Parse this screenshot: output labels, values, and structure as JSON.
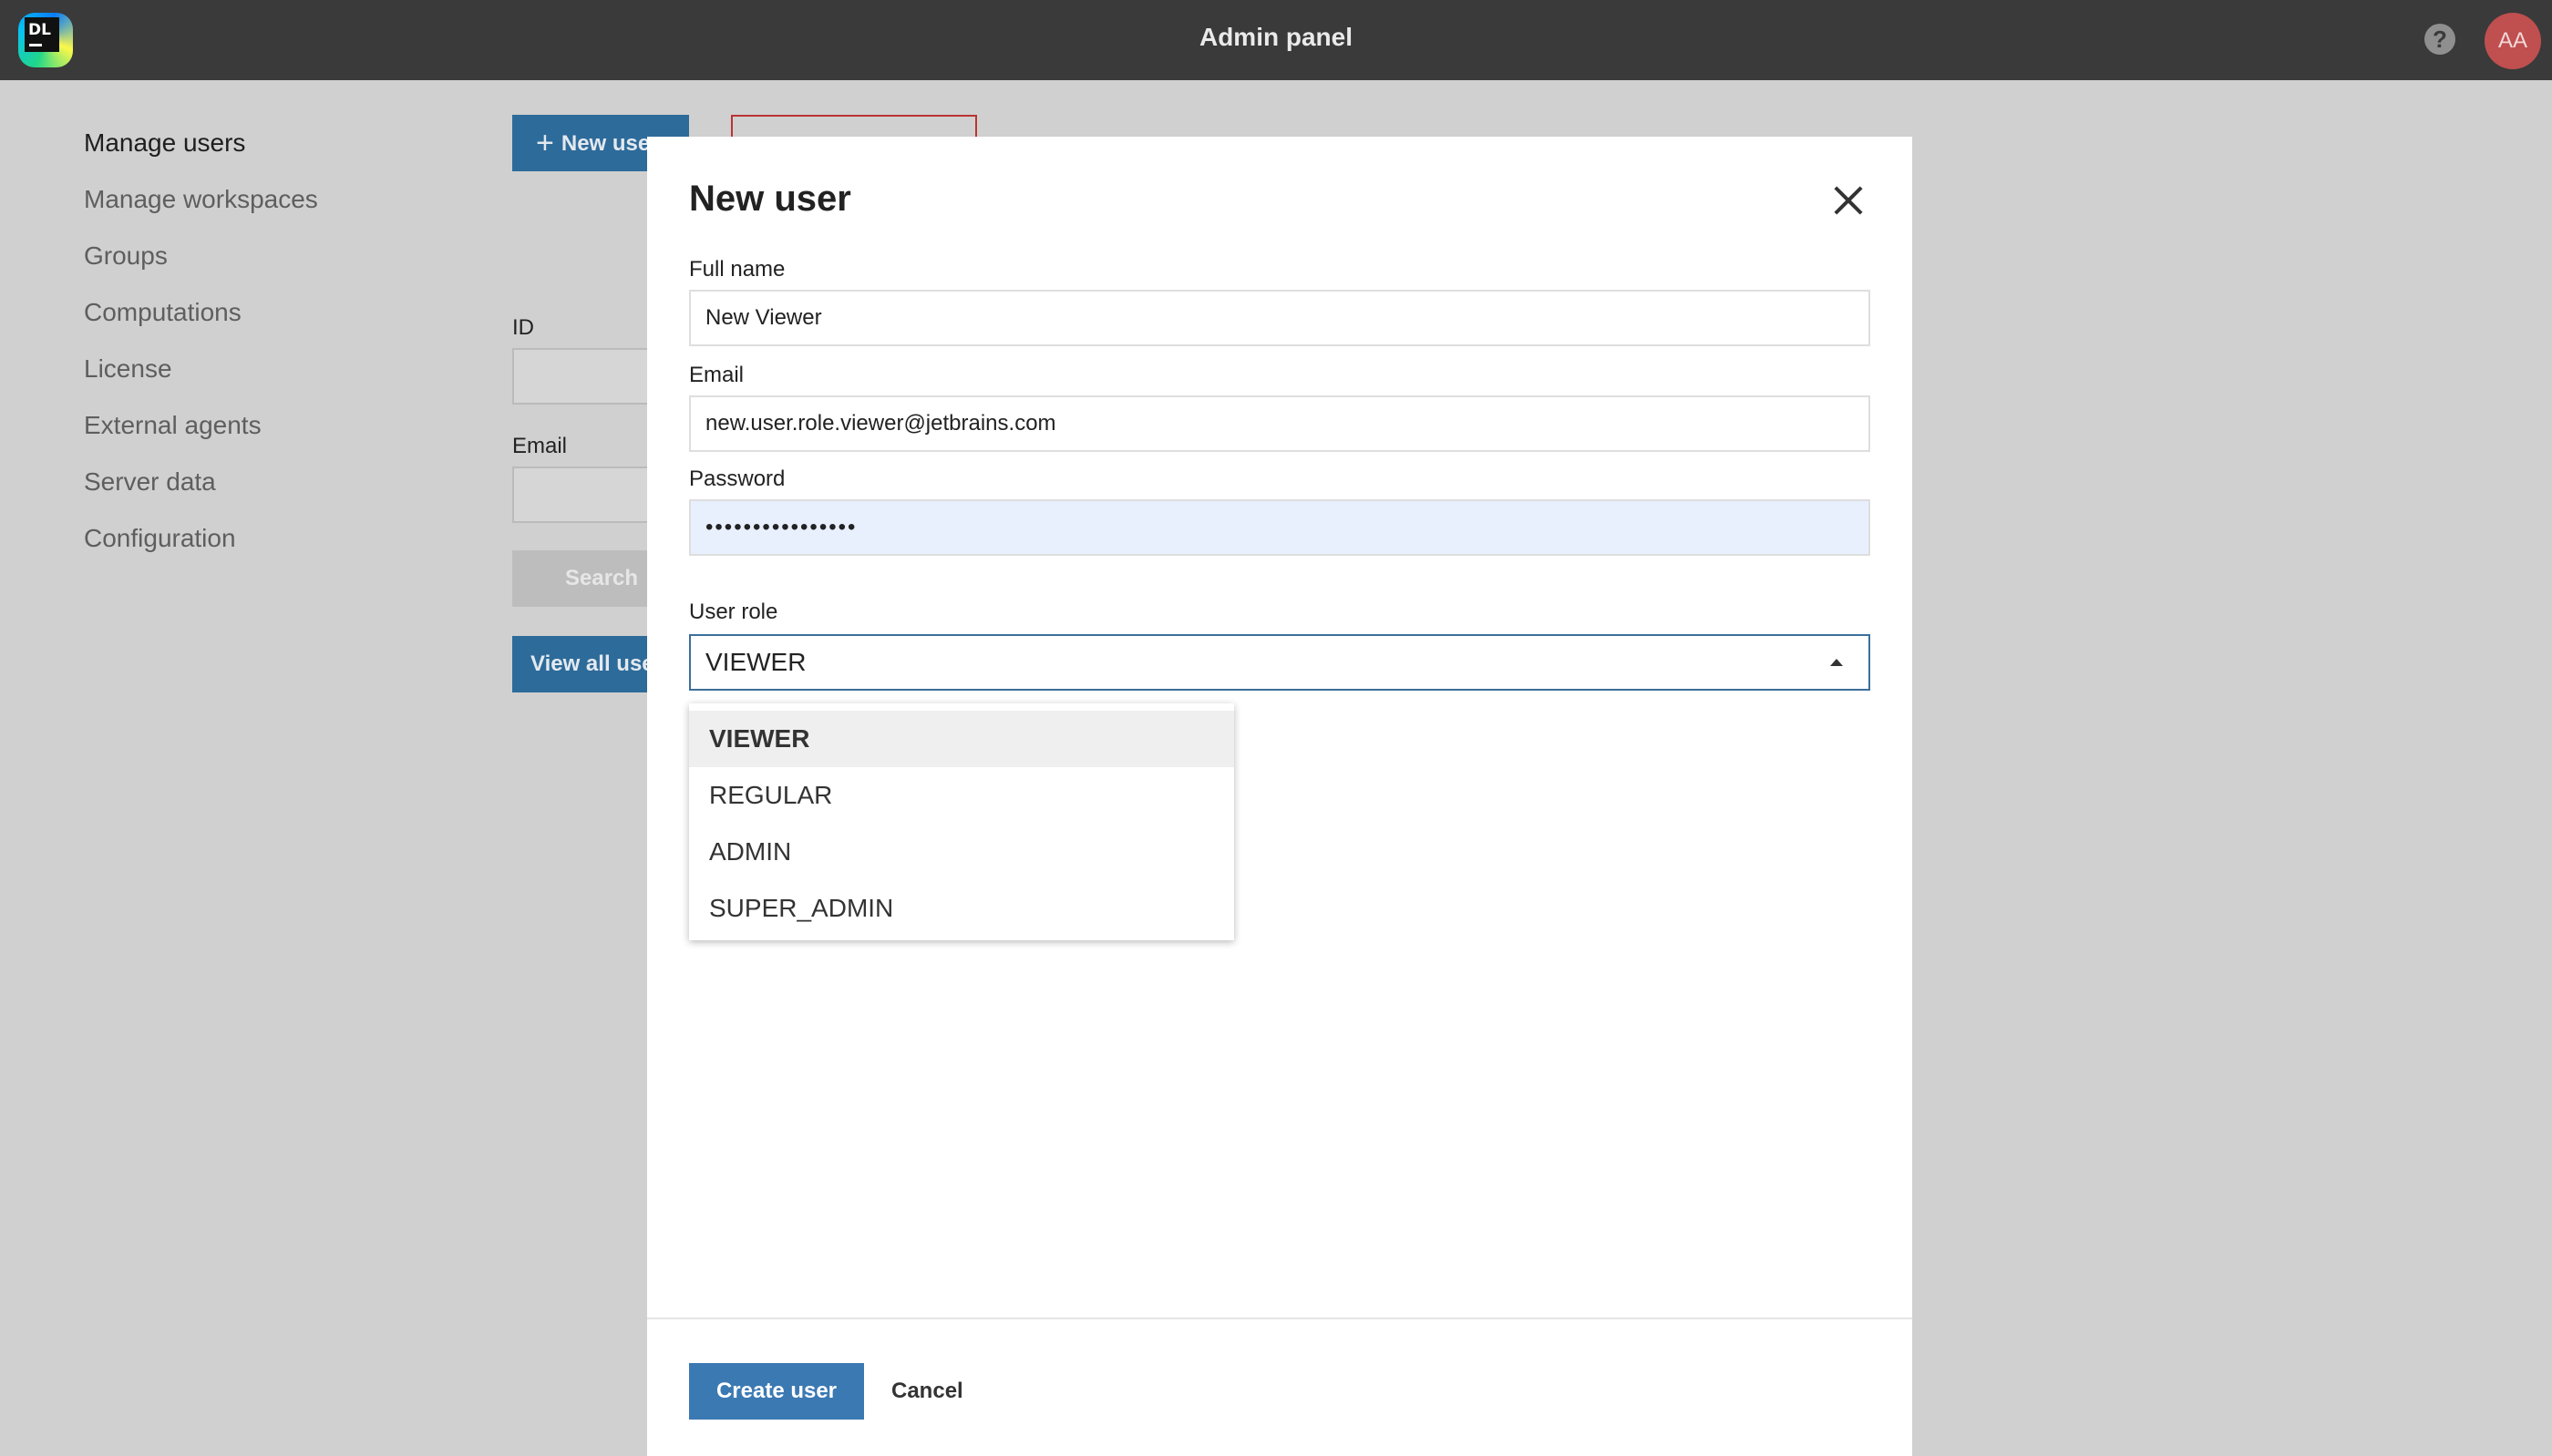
{
  "header": {
    "title": "Admin panel",
    "logo_text": "DL",
    "help_icon": "question-mark-icon",
    "avatar_initials": "AA",
    "colors": {
      "bar": "#3a3a3a",
      "avatar": "#c04f4f"
    }
  },
  "sidebar": {
    "items": [
      {
        "label": "Manage users",
        "active": true
      },
      {
        "label": "Manage workspaces"
      },
      {
        "label": "Groups"
      },
      {
        "label": "Computations"
      },
      {
        "label": "License"
      },
      {
        "label": "External agents"
      },
      {
        "label": "Server data"
      },
      {
        "label": "Configuration"
      }
    ]
  },
  "background": {
    "new_user_label": "New user",
    "id_label": "ID",
    "email_label": "Email",
    "search_label": "Search",
    "view_all_label": "View all users"
  },
  "modal": {
    "title": "New user",
    "close_icon": "close-icon",
    "full_name_label": "Full name",
    "full_name_value": "New Viewer",
    "email_label": "Email",
    "email_value": "new.user.role.viewer@jetbrains.com",
    "password_label": "Password",
    "password_value": "••••••••••••••••",
    "user_role_label": "User role",
    "user_role_value": "VIEWER",
    "role_options": [
      "VIEWER",
      "REGULAR",
      "ADMIN",
      "SUPER_ADMIN"
    ],
    "create_label": "Create user",
    "cancel_label": "Cancel",
    "colors": {
      "primary": "#3b79b3",
      "autofill": "#e8f0fe"
    }
  }
}
